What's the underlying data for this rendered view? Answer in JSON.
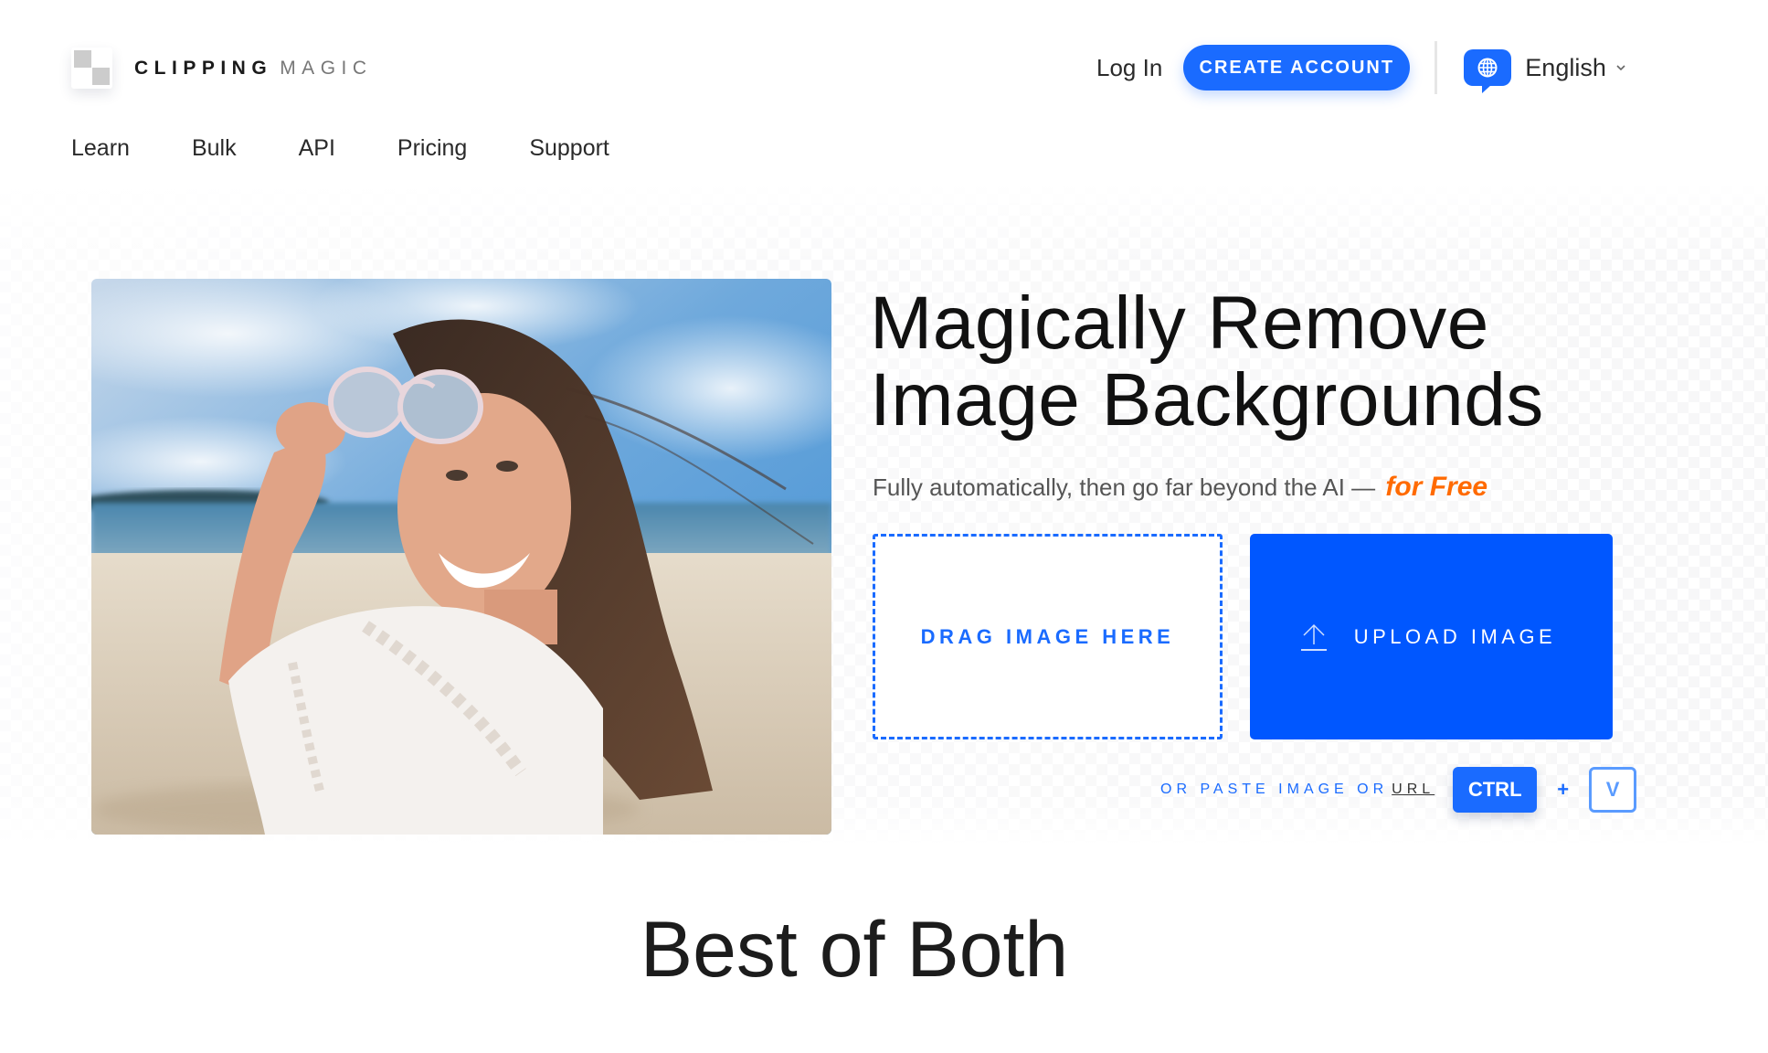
{
  "brand": {
    "name_bold": "CLIPPING",
    "name_light": "MAGIC"
  },
  "header": {
    "login_label": "Log In",
    "create_account_label": "CREATE ACCOUNT",
    "language": {
      "icon": "globe-icon",
      "selected": "English"
    }
  },
  "nav": {
    "items": [
      {
        "label": "Learn"
      },
      {
        "label": "Bulk"
      },
      {
        "label": "API"
      },
      {
        "label": "Pricing"
      },
      {
        "label": "Support"
      }
    ]
  },
  "hero": {
    "image_alt": "Smiling woman on beach lifting sunglasses",
    "headline_line1": "Magically Remove",
    "headline_line2": "Image Backgrounds",
    "subtitle": "Fully automatically, then go far beyond the AI —",
    "subtitle_highlight": "for Free",
    "drag_label": "DRAG IMAGE HERE",
    "upload_label": "UPLOAD IMAGE",
    "upload_icon": "upload-arrow-icon",
    "paste_text": "OR PASTE IMAGE OR",
    "paste_url_label": "URL",
    "shortcut": {
      "key1": "CTRL",
      "plus": "+",
      "key2": "V"
    }
  },
  "sections": {
    "next_title": "Best of Both"
  },
  "colors": {
    "accent": "#1a6bff",
    "upload_bg": "#0057ff",
    "highlight": "#ff6a00",
    "text": "#1c1c1c"
  }
}
